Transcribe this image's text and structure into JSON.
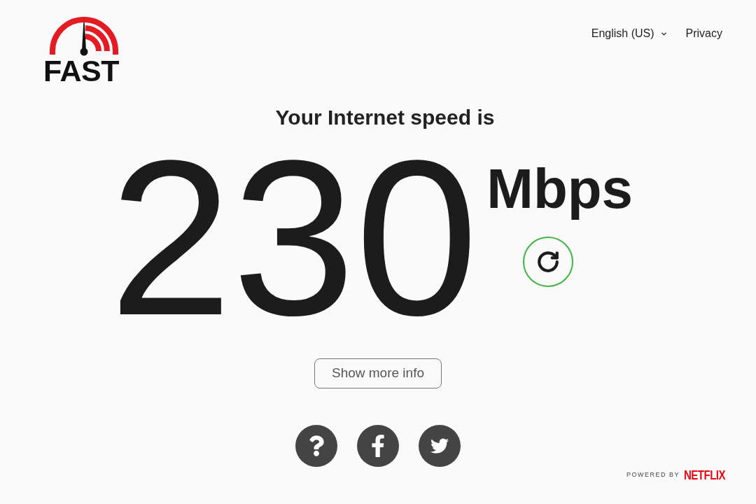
{
  "logo": {
    "wordmark": "FAST"
  },
  "nav": {
    "language": "English (US)",
    "privacy": "Privacy"
  },
  "result": {
    "heading": "Your Internet speed is",
    "speed": "230",
    "unit": "Mbps"
  },
  "more_info_button": "Show more info",
  "footer": {
    "powered_by": "POWERED BY",
    "brand": "NETFLIX"
  }
}
